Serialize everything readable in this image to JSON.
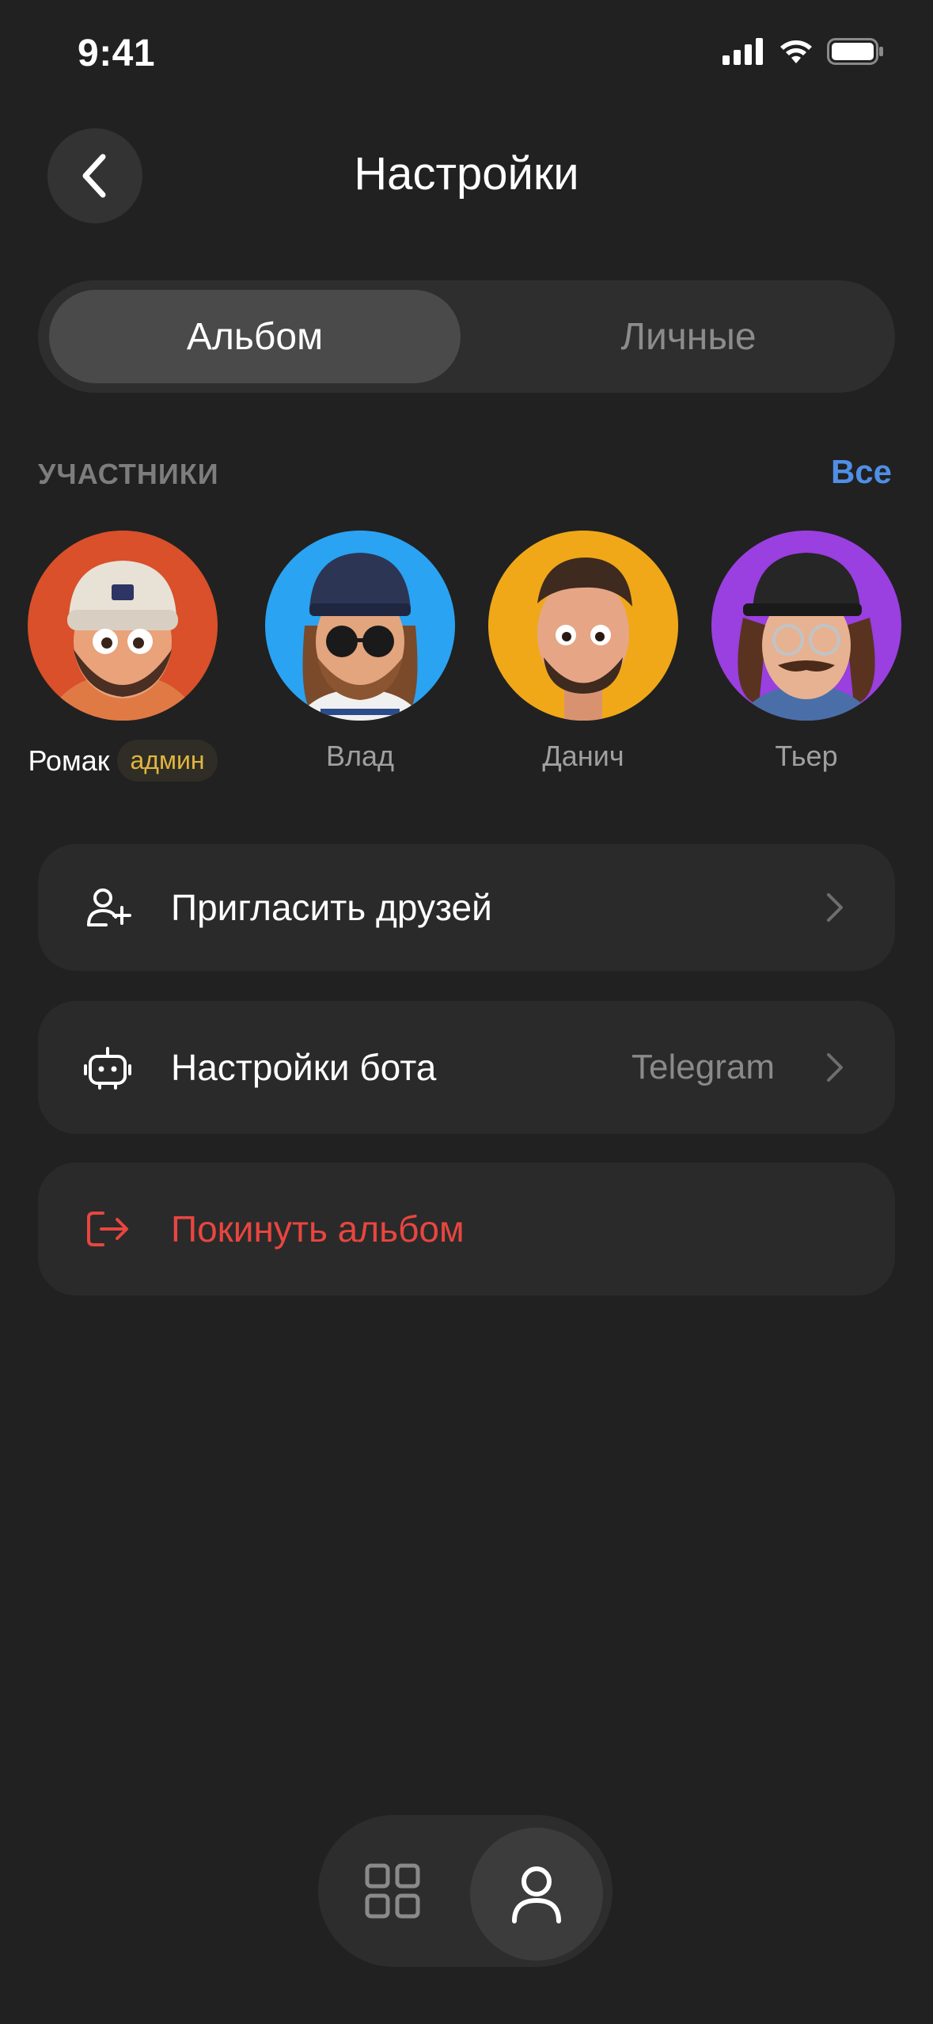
{
  "status_bar": {
    "time": "9:41"
  },
  "header": {
    "title": "Настройки"
  },
  "tabs": [
    {
      "label": "Альбом",
      "active": true
    },
    {
      "label": "Личные",
      "active": false
    }
  ],
  "members_section": {
    "label": "УЧАСТНИКИ",
    "all_link": "Все",
    "members": [
      {
        "name": "Ромак",
        "badge": "админ",
        "avatar_bg": "#d9502a"
      },
      {
        "name": "Влад",
        "avatar_bg": "#2aa3f2"
      },
      {
        "name": "Данич",
        "avatar_bg": "#f0a818"
      },
      {
        "name": "Тьер",
        "avatar_bg": "#9a3fe0"
      }
    ]
  },
  "rows": {
    "invite": {
      "label": "Пригласить друзей",
      "icon": "user-plus-icon"
    },
    "bot": {
      "label": "Настройки бота",
      "value": "Telegram",
      "icon": "robot-icon"
    },
    "leave": {
      "label": "Покинуть альбом",
      "icon": "logout-icon",
      "color": "#e8463f"
    }
  },
  "bottom_nav": {
    "items": [
      {
        "icon": "grid-icon",
        "active": false
      },
      {
        "icon": "user-icon",
        "active": true
      }
    ]
  },
  "colors": {
    "background": "#212121",
    "accent_blue": "#4f8fe6",
    "danger": "#e8463f",
    "admin_badge": "#e2b53f"
  }
}
